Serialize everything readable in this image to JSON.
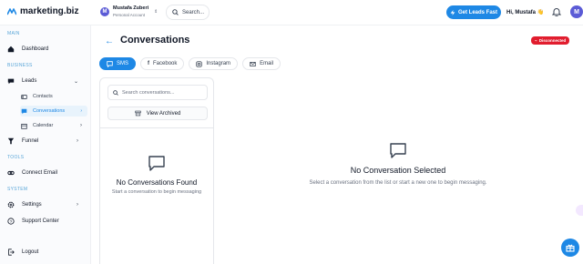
{
  "app": {
    "name": "marketing.biz"
  },
  "account": {
    "initial": "M",
    "name": "Mustafa Zuberi",
    "type": "Personal Account"
  },
  "top_search": {
    "label": "Search..."
  },
  "header": {
    "leads_button": "Get Leads Fast",
    "greeting": "Hi, Mustafa 👋",
    "avatar_initial": "M"
  },
  "sidebar": {
    "sections": {
      "main": "MAIN",
      "business": "BUSINESS",
      "tools": "TOOLS",
      "system": "SYSTEM"
    },
    "items": {
      "dashboard": "Dashboard",
      "leads": "Leads",
      "contacts": "Contacts",
      "conversations": "Conversations",
      "calendar": "Calendar",
      "funnel": "Funnel",
      "connect_email": "Connect Email",
      "settings": "Settings",
      "support": "Support Center",
      "logout": "Logout"
    }
  },
  "page": {
    "title": "Conversations",
    "status": "Disconnected"
  },
  "tabs": {
    "sms": "SMS",
    "facebook": "Facebook",
    "instagram": "Instagram",
    "email": "Email"
  },
  "conversation_list": {
    "search_placeholder": "Search conversations...",
    "archived_button": "View Archived",
    "empty_title": "No Conversations Found",
    "empty_subtitle": "Start a conversation to begin messaging"
  },
  "detail": {
    "empty_title": "No Conversation Selected",
    "empty_subtitle": "Select a conversation from the list or start a new one to begin messaging."
  },
  "colors": {
    "accent": "#1e88e5",
    "danger": "#e11d2e",
    "avatar": "#5b5bd6"
  },
  "icons": {
    "logo": "logo-mark-icon",
    "search": "search-icon",
    "bell": "bell-icon",
    "chat": "chat-bubble-icon",
    "archive": "archive-icon",
    "fab": "gift-icon"
  }
}
